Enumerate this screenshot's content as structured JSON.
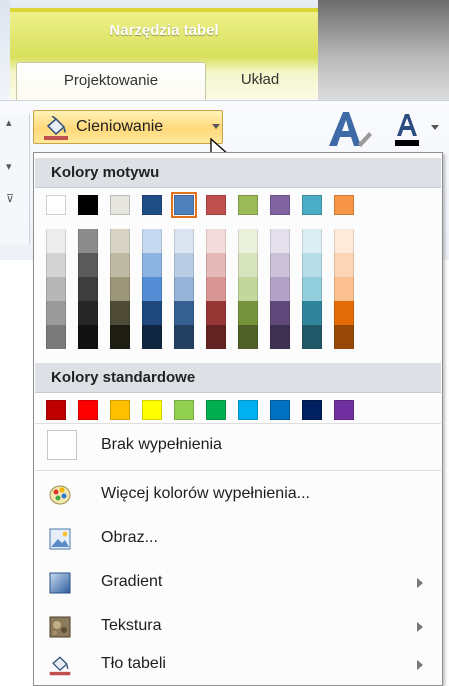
{
  "ribbon": {
    "context_title": "Narzędzia tabel",
    "tabs": [
      {
        "label": "Projektowanie",
        "active": true
      },
      {
        "label": "Układ",
        "active": false
      }
    ],
    "shading_button": {
      "label": "Cieniowanie"
    }
  },
  "menu": {
    "theme_header": "Kolory motywu",
    "standard_header": "Kolory standardowe",
    "theme_colors": [
      "#ffffff",
      "#000000",
      "#e6e6de",
      "#1f4e87",
      "#4f81bd",
      "#c0504d",
      "#9bbb59",
      "#8064a2",
      "#4bacc6",
      "#f79646"
    ],
    "selected_theme_index": 4,
    "tint_columns": [
      [
        "#ececec",
        "#d3d3d3",
        "#b7b7b7",
        "#9b9b9b",
        "#7a7a7a"
      ],
      [
        "#8b8b8b",
        "#5a5a5a",
        "#3e3e3e",
        "#262626",
        "#111111"
      ],
      [
        "#d6d3c5",
        "#bdb9a2",
        "#9a9677",
        "#4e4b37",
        "#1e1d14"
      ],
      [
        "#c6d9f1",
        "#8db3e2",
        "#548dd4",
        "#1f497d",
        "#10253f"
      ],
      [
        "#dbe5f1",
        "#b8cce4",
        "#95b3d7",
        "#366092",
        "#244061"
      ],
      [
        "#f2dcdb",
        "#e5b9b7",
        "#d99694",
        "#953734",
        "#632423"
      ],
      [
        "#ebf1dd",
        "#d7e3bc",
        "#c3d69b",
        "#76923c",
        "#4f6128"
      ],
      [
        "#e5e0ec",
        "#ccc1d9",
        "#b2a2c7",
        "#5f497a",
        "#3f3151"
      ],
      [
        "#dbeef3",
        "#b7dde8",
        "#92cddc",
        "#31859b",
        "#205867"
      ],
      [
        "#fdeada",
        "#fbd5b5",
        "#fac08f",
        "#e36c09",
        "#974806"
      ]
    ],
    "standard_colors": [
      "#c00000",
      "#ff0000",
      "#ffc000",
      "#ffff00",
      "#92d050",
      "#00b050",
      "#00b0f0",
      "#0070c0",
      "#002060",
      "#7030a0"
    ],
    "no_fill": "Brak wypełnienia",
    "items": [
      {
        "label": "Więcej kolorów wypełnienia...",
        "icon": "palette-icon",
        "submenu": false
      },
      {
        "label": "Obraz...",
        "icon": "picture-icon",
        "submenu": false
      },
      {
        "label": "Gradient",
        "icon": "gradient-icon",
        "submenu": true
      },
      {
        "label": "Tekstura",
        "icon": "texture-icon",
        "submenu": true
      },
      {
        "label": "Tło tabeli",
        "icon": "paint-bucket-icon",
        "submenu": true
      }
    ]
  }
}
